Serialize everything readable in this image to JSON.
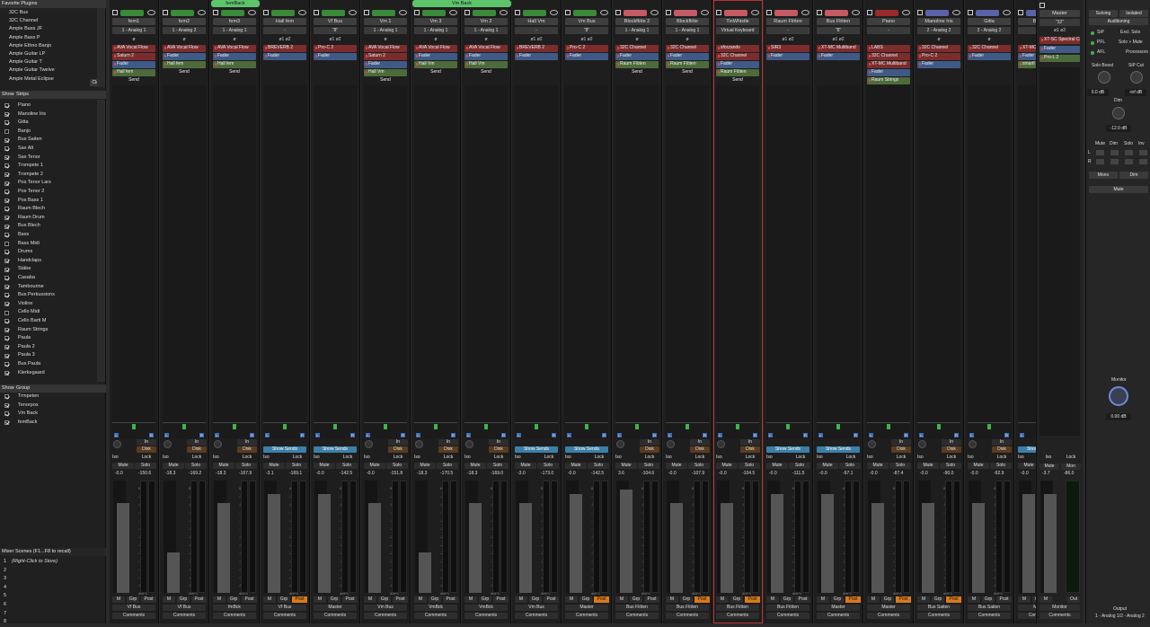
{
  "favorites": {
    "header": "Favorite Plugins",
    "items": [
      "32C Bus",
      "32C Channel",
      "Ample Bass JF",
      "Ample Bass P",
      "Ample Ethno Banjo",
      "Ample Guitar LP",
      "Ample Guitar T",
      "Ample Guitar Twelve",
      "Ample Metal Eclipse"
    ],
    "clear": "Clear"
  },
  "strips_panel": {
    "col1": "Show",
    "col2": "Strips",
    "items": [
      [
        "Piano",
        true
      ],
      [
        "Manoline Iris",
        true
      ],
      [
        "Gitta",
        true
      ],
      [
        "Banjo",
        false
      ],
      [
        "Bus Saiten",
        true
      ],
      [
        "Sax Alt",
        true
      ],
      [
        "Sax Tenor",
        true
      ],
      [
        "Trompete 1",
        true
      ],
      [
        "Trompete 2",
        true
      ],
      [
        "Pos Tenor Lars",
        true
      ],
      [
        "Pos Tenor 2",
        true
      ],
      [
        "Pos Bass 1",
        true
      ],
      [
        "Raum Blech",
        true
      ],
      [
        "Raum Drum",
        true
      ],
      [
        "Bus Blech",
        true
      ],
      [
        "Bass",
        true
      ],
      [
        "Bass Midi",
        false
      ],
      [
        "Drums",
        true
      ],
      [
        "Handclaps",
        true
      ],
      [
        "Stäbe",
        true
      ],
      [
        "Casaba",
        true
      ],
      [
        "Tambourine",
        true
      ],
      [
        "Bus Perkussions",
        true
      ],
      [
        "Violine",
        true
      ],
      [
        "Cello Midi",
        false
      ],
      [
        "Cello Barti M",
        true
      ],
      [
        "Raum Strings",
        true
      ],
      [
        "Paula",
        true
      ],
      [
        "Paula 2",
        true
      ],
      [
        "Paula 3",
        true
      ],
      [
        "Bus Paula",
        true
      ],
      [
        "Klerkegaard",
        true
      ]
    ]
  },
  "groups_panel": {
    "col1": "Show",
    "col2": "Group",
    "items": [
      [
        "Trmpeten",
        true
      ],
      [
        "Tenorpos",
        true
      ],
      [
        "Vm Back",
        true
      ],
      [
        "femBack",
        true
      ]
    ]
  },
  "scenes": {
    "header": "Mixer Scenes (F1...F8 to recall)",
    "items": [
      [
        "1",
        "(Right-Click to Store)"
      ],
      [
        "2",
        ""
      ],
      [
        "3",
        ""
      ],
      [
        "4",
        ""
      ],
      [
        "5",
        ""
      ],
      [
        "6",
        ""
      ],
      [
        "7",
        ""
      ],
      [
        "8",
        ""
      ]
    ]
  },
  "groups_top": [
    {
      "label": "femBack"
    },
    {
      "label": "Vm Back"
    }
  ],
  "strips": [
    {
      "name": "fem1",
      "io": "1 - Analog 1",
      "ph": "ø",
      "ins": [
        [
          "AVA Vocal Flow",
          "red"
        ],
        [
          "Saturn 2",
          "red"
        ],
        [
          "Fader",
          "blue"
        ],
        [
          "Hall fem",
          "grn"
        ],
        [
          "Send",
          "send"
        ]
      ],
      "rec": true,
      "in": "In",
      "disk": "Disk",
      "g1": "-0.0",
      "g2": "-150.6",
      "out": "Vf Bus",
      "pst": false,
      "sends": false
    },
    {
      "name": "fem2",
      "io": "1 - Analog 2",
      "ph": "ø",
      "ins": [
        [
          "AVA Vocal Flow",
          "red"
        ],
        [
          "Fader",
          "blue"
        ],
        [
          "Hall fem",
          "grn"
        ],
        [
          "Send",
          "send"
        ]
      ],
      "rec": true,
      "in": "In",
      "disk": "Disk",
      "g1": "-18.3",
      "g2": "-169.2",
      "out": "Vf Bus",
      "pst": false,
      "sends": false
    },
    {
      "name": "fem3",
      "io": "1 - Analog 1",
      "ph": "ø",
      "ins": [
        [
          "AVA Vocal Flow",
          "red"
        ],
        [
          "Fader",
          "blue"
        ],
        [
          "Hall fem",
          "grn"
        ],
        [
          "Send",
          "send"
        ]
      ],
      "rec": true,
      "in": "In",
      "disk": "Disk",
      "g1": "-18.3",
      "g2": "-167.9",
      "out": "fmBck",
      "pst": false,
      "sends": false
    },
    {
      "name": "Hall fem",
      "io": "-",
      "ph": "ø1    ø2",
      "ins": [
        [
          "BREVERB 2",
          "red"
        ],
        [
          "Fader",
          "blue"
        ]
      ],
      "rec": false,
      "g1": "-3.1",
      "g2": "-169.1",
      "out": "Vf Bus",
      "pst": true,
      "sends": true
    },
    {
      "name": "Vf Bus",
      "io": "\"8\"",
      "ph": "ø1    ø2",
      "ins": [
        [
          "Pro-C 2",
          "red"
        ],
        [
          "Fader",
          "blue"
        ]
      ],
      "rec": false,
      "g1": "-0.0",
      "g2": "-142.5",
      "out": "Master",
      "pst": false,
      "sends": true
    },
    {
      "name": "Vm 1",
      "io": "1 - Analog 1",
      "ph": "ø",
      "ins": [
        [
          "AVA Vocal Flow",
          "red"
        ],
        [
          "Saturn 2",
          "red"
        ],
        [
          "Fader",
          "blue"
        ],
        [
          "Hall Vm",
          "grn"
        ],
        [
          "Send",
          "send"
        ]
      ],
      "rec": true,
      "in": "In",
      "disk": "Disk",
      "g1": "-0.0",
      "g2": "-151.8",
      "out": "Vm Bus",
      "pst": false,
      "sends": false
    },
    {
      "name": "Vm 3",
      "io": "1 - Analog 1",
      "ph": "ø",
      "ins": [
        [
          "AVA Vocal Flow",
          "red"
        ],
        [
          "Fader",
          "blue"
        ],
        [
          "Hall Vm",
          "grn"
        ],
        [
          "Send",
          "send"
        ]
      ],
      "rec": true,
      "in": "In",
      "disk": "Disk",
      "g1": "-18.3",
      "g2": "-170.5",
      "out": "VmBck",
      "pst": false,
      "sends": false
    },
    {
      "name": "Vm 2",
      "io": "1 - Analog 1",
      "ph": "ø",
      "ins": [
        [
          "AVA Vocal Flow",
          "red"
        ],
        [
          "Fader",
          "blue"
        ],
        [
          "Hall Vm",
          "grn"
        ],
        [
          "Send",
          "send"
        ]
      ],
      "rec": true,
      "in": "In",
      "disk": "Disk",
      "g1": "-18.3",
      "g2": "-169.0",
      "out": "VmBck",
      "pst": false,
      "sends": false
    },
    {
      "name": "Hall Vm",
      "io": "-",
      "ph": "ø1    ø2",
      "ins": [
        [
          "BREVERB 2",
          "red"
        ],
        [
          "Fader",
          "blue"
        ]
      ],
      "rec": false,
      "g1": "-3.0",
      "g2": "-173.0",
      "out": "Vm Bus",
      "pst": false,
      "sends": true
    },
    {
      "name": "Vm Bus",
      "io": "\"8\"",
      "ph": "ø1    ø2",
      "ins": [
        [
          "Pro-C 2",
          "red"
        ],
        [
          "Fader",
          "blue"
        ]
      ],
      "rec": false,
      "g1": "-0.0",
      "g2": "-142.5",
      "out": "Master",
      "pst": true,
      "sends": true
    },
    {
      "name": "Blockflöte 2",
      "io": "1 - Analog 1",
      "ph": "ø",
      "ins": [
        [
          "32C Channel",
          "red"
        ],
        [
          "Fader",
          "blue"
        ],
        [
          "Raum Flöten",
          "grn"
        ],
        [
          "Send",
          "send"
        ]
      ],
      "rec": true,
      "in": "In",
      "disk": "Disk",
      "g1": "3.6",
      "g2": "-104.6",
      "out": "Bus Flöten",
      "pst": false,
      "sends": false
    },
    {
      "name": "Blockflöte",
      "io": "1 - Analog 1",
      "ph": "ø",
      "ins": [
        [
          "32C Channel",
          "red"
        ],
        [
          "Fader",
          "blue"
        ],
        [
          "Raum Flöten",
          "grn"
        ],
        [
          "Send",
          "send"
        ]
      ],
      "rec": true,
      "in": "In",
      "disk": "Disk",
      "g1": "-0.0",
      "g2": "-107.9",
      "out": "Bus Flöten",
      "pst": true,
      "sends": false
    },
    {
      "name": "TinWhistle",
      "io": "Virtual Keyboard",
      "ph": "",
      "ins": [
        [
          "sforzando",
          "red"
        ],
        [
          "32C Channel",
          "red"
        ],
        [
          "Fader",
          "blue"
        ],
        [
          "Raum Flöten",
          "grn"
        ],
        [
          "Send",
          "send"
        ]
      ],
      "rec": true,
      "in": "In",
      "disk": "Disk",
      "g1": "-0.0",
      "g2": "-104.5",
      "out": "Bus Flöten",
      "pst": true,
      "sends": false,
      "sel": true
    },
    {
      "name": "Raum Flöten",
      "io": "-",
      "ph": "ø1    ø2",
      "ins": [
        [
          "SIR3",
          "red"
        ],
        [
          "Fader",
          "blue"
        ]
      ],
      "rec": false,
      "g1": "-0.0",
      "g2": "-111.5",
      "out": "Bus Flöten",
      "pst": false,
      "sends": true
    },
    {
      "name": "Bus Flöten",
      "io": "\"8\"",
      "ph": "ø1    ø2",
      "ins": [
        [
          "XT-MC Multiband",
          "red"
        ],
        [
          "Fader",
          "blue"
        ]
      ],
      "rec": false,
      "g1": "-0.0",
      "g2": "-97.1",
      "out": "Master",
      "pst": true,
      "sends": true
    },
    {
      "name": "Piano",
      "io": "-",
      "ph": "",
      "ins": [
        [
          "LABS",
          "red"
        ],
        [
          "32C Channel",
          "red"
        ],
        [
          "XT-MC Multiband",
          "red"
        ],
        [
          "Fader",
          "blue"
        ],
        [
          "Raum Strings",
          "grn"
        ],
        [
          "Send",
          "send"
        ]
      ],
      "rec": true,
      "in": "In",
      "disk": "Disk",
      "g1": "-0.0",
      "g2": "-87.4",
      "out": "Master",
      "pst": true,
      "sends": false
    },
    {
      "name": "Manoline Iris",
      "io": "2 - Analog 2",
      "ph": "ø",
      "ins": [
        [
          "32C Channel",
          "red"
        ],
        [
          "Pro-C 2",
          "red"
        ],
        [
          "Fader",
          "blue"
        ]
      ],
      "rec": true,
      "in": "In",
      "disk": "Disk",
      "g1": "-0.0",
      "g2": "-90.0",
      "out": "Bus Saiten",
      "pst": true,
      "sends": false
    },
    {
      "name": "Gitta",
      "io": "2 - Analog 2",
      "ph": "ø",
      "ins": [
        [
          "32C Channel",
          "red"
        ],
        [
          "Fader",
          "blue"
        ]
      ],
      "rec": true,
      "in": "In",
      "disk": "Disk",
      "g1": "-0.0",
      "g2": "-92.9",
      "out": "Bus Saiten",
      "pst": false,
      "sends": false
    },
    {
      "name": "Bus S",
      "io": "\"8\"",
      "ph": "ø1",
      "ins": [
        [
          "XT-MC",
          "red"
        ],
        [
          "Fader",
          "blue"
        ],
        [
          "smartl",
          "grn"
        ]
      ],
      "rec": false,
      "g1": "-0.0",
      "g2": "",
      "out": "Maste",
      "pst": true,
      "sends": true
    }
  ],
  "labels": {
    "iso": "Iso",
    "lock": "Lock",
    "mute": "Mute",
    "solo": "Solo",
    "m": "M",
    "grp": "Grp",
    "post": "Post",
    "comments": "Comments",
    "show_sends": "Show Sends",
    "scale": [
      "0",
      "-3",
      "-5",
      "-10",
      "-15",
      "-18",
      "-20",
      "-25",
      "-30",
      "-35",
      "-40",
      "-48",
      "-54",
      "dBFS"
    ]
  },
  "master": {
    "name": "Master",
    "io": "\"32\"",
    "ph": "ø1    ø2",
    "ins": [
      [
        "XT-SC Spectral Cl",
        "red"
      ],
      [
        "Fader",
        "blue"
      ],
      [
        "Pro-L 2",
        "grn"
      ]
    ],
    "iso": "Iso",
    "lock": "Lock",
    "mute": "Mute",
    "mon": "Mon",
    "g1": "-3.7",
    "g2": "-86.0",
    "m": "M",
    "out": "Out",
    "name2": "Monitor",
    "comments": "Comments"
  },
  "monitor": {
    "soloing": "Soloing",
    "isolated": "Isolated",
    "auditioning": "Auditioning",
    "sip": "SiP",
    "excl_solo": "Excl. Solo",
    "pfl": "PFL",
    "solo_mute": "Solo » Mute",
    "afl": "AFL",
    "processors": "Processors",
    "solo_boost": "Solo Boost",
    "sip_cut": "SiP Cut",
    "boost_val": "0.0 dB",
    "cut_val": "-inf dB",
    "dim": "Dim",
    "dim_val": "-12.0 dB",
    "cols": [
      "Mute",
      "Dim",
      "Solo",
      "Inv"
    ],
    "rows": [
      "L",
      "R"
    ],
    "mono": "Mono",
    "dim_btn": "Dim",
    "mute": "Mute",
    "monitor": "Monitor",
    "mon_val": "0.00 dB",
    "output": "Output",
    "output_val": "1 - Analog 1/2 - Analog 2"
  }
}
